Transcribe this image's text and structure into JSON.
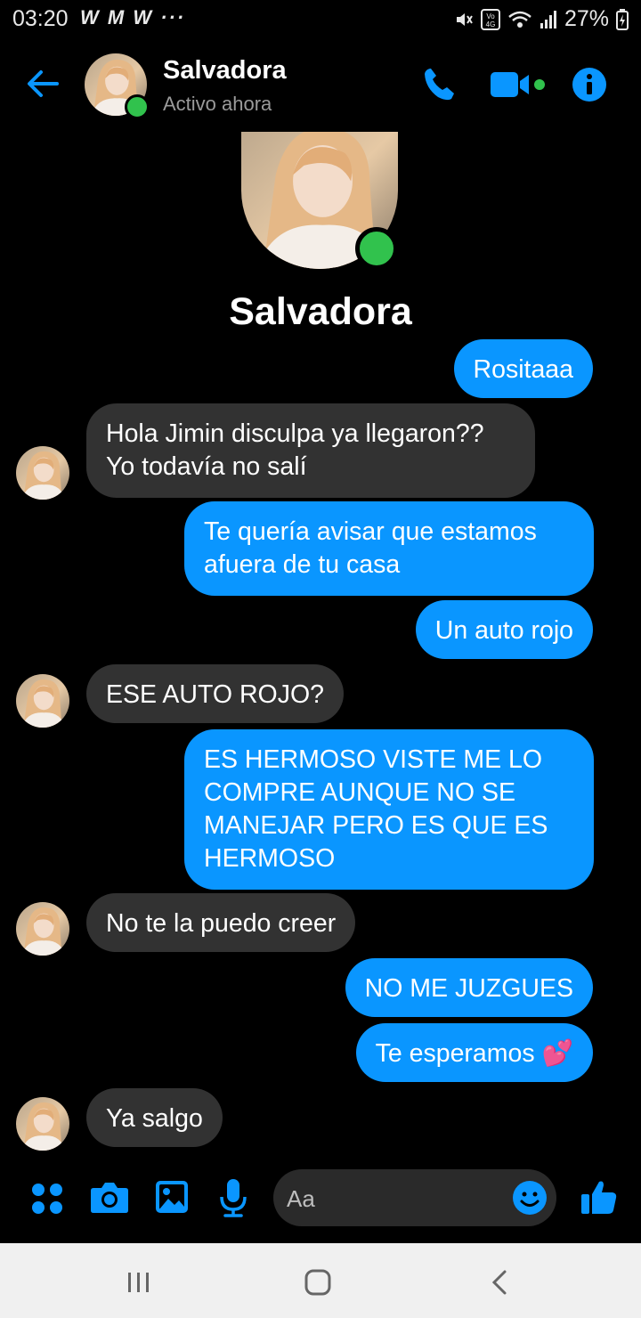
{
  "status_bar": {
    "time": "03:20",
    "app_icons": "W M W ···",
    "battery": "27%"
  },
  "header": {
    "contact_name": "Salvadora",
    "status": "Activo ahora",
    "icons": [
      "back-arrow-icon",
      "phone-icon",
      "video-camera-icon",
      "info-icon"
    ],
    "accent_color": "#0a96ff",
    "online_color": "#31c24d"
  },
  "profile": {
    "name": "Salvadora"
  },
  "messages": [
    {
      "from": "me",
      "text": "Rositaaa"
    },
    {
      "from": "them",
      "text": "Hola Jimin disculpa ya llegaron?? Yo todavía no salí"
    },
    {
      "from": "me",
      "text": "Te quería avisar que estamos afuera de tu casa"
    },
    {
      "from": "me",
      "text": "Un auto rojo"
    },
    {
      "from": "them",
      "text": "ESE AUTO ROJO?"
    },
    {
      "from": "me",
      "text": "ES HERMOSO VISTE ME LO COMPRE AUNQUE NO SE MANEJAR PERO ES QUE ES HERMOSO"
    },
    {
      "from": "them",
      "text": "No te la puedo creer"
    },
    {
      "from": "me",
      "text": "NO ME JUZGUES"
    },
    {
      "from": "me",
      "text": "Te esperamos 💕"
    },
    {
      "from": "them",
      "text": "Ya salgo"
    }
  ],
  "composer": {
    "placeholder": "Aa",
    "icons": [
      "apps-grid-icon",
      "camera-icon",
      "gallery-icon",
      "microphone-icon",
      "emoji-icon",
      "thumbs-up-icon"
    ]
  },
  "nav_bar": {
    "icons": [
      "recent-apps-icon",
      "home-icon",
      "back-icon"
    ]
  }
}
